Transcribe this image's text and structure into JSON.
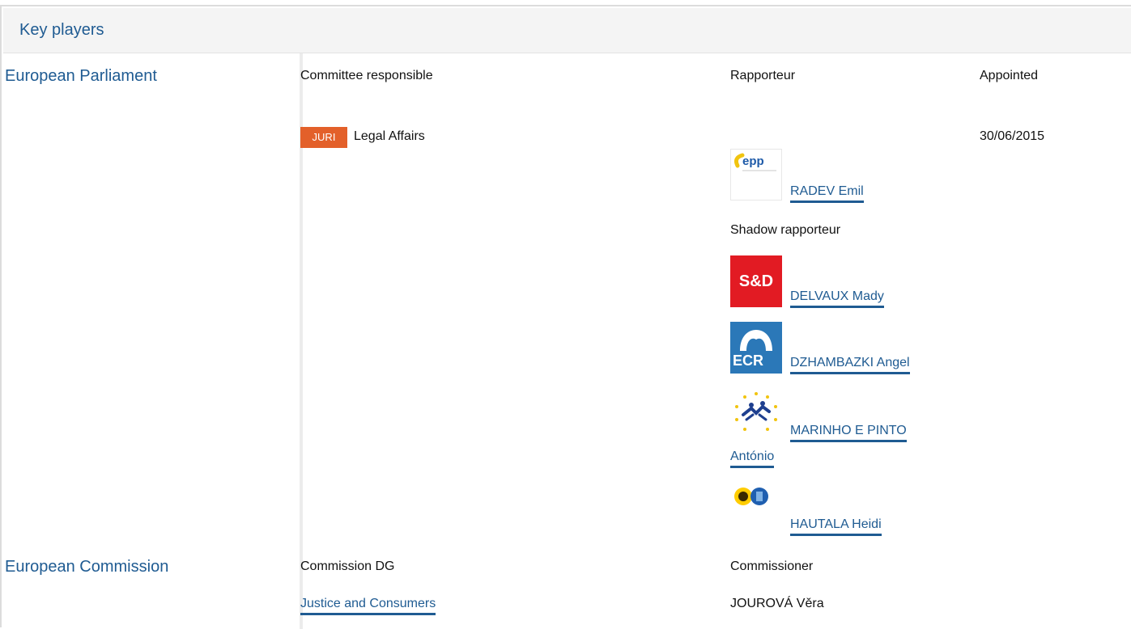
{
  "section": {
    "title": "Key players"
  },
  "europarl": {
    "institution": "European Parliament",
    "headers": {
      "committee": "Committee responsible",
      "rapporteur": "Rapporteur",
      "appointed": "Appointed"
    },
    "committee": {
      "badge": "JURI",
      "badge_color": "#e3602a",
      "name": "Legal Affairs",
      "appointed": "30/06/2015"
    },
    "rapporteur": {
      "group_icon": "epp-logo",
      "name": "RADEV Emil"
    },
    "shadow_label": "Shadow rapporteur",
    "shadows": [
      {
        "group_icon": "s-and-d-logo",
        "group_label": "S&D",
        "name_line1": "DELVAUX Mady",
        "name_line2": ""
      },
      {
        "group_icon": "ecr-logo",
        "group_label": "ECR",
        "name_line1": "DZHAMBAZKI Angel",
        "name_line2": ""
      },
      {
        "group_icon": "alde-logo",
        "group_label": "",
        "name_line1": "MARINHO E PINTO",
        "name_line2": "António"
      },
      {
        "group_icon": "greens-efa-logo",
        "group_label": "",
        "name_line1": "HAUTALA Heidi",
        "name_line2": ""
      }
    ]
  },
  "commission": {
    "institution": "European Commission",
    "headers": {
      "dg": "Commission DG",
      "commissioner": "Commissioner"
    },
    "dg": "Justice and Consumers",
    "commissioner": "JOUROVÁ Věra"
  },
  "colors": {
    "link": "#1f5b92",
    "header_bg": "#f4f4f4",
    "divider": "#ececec"
  }
}
